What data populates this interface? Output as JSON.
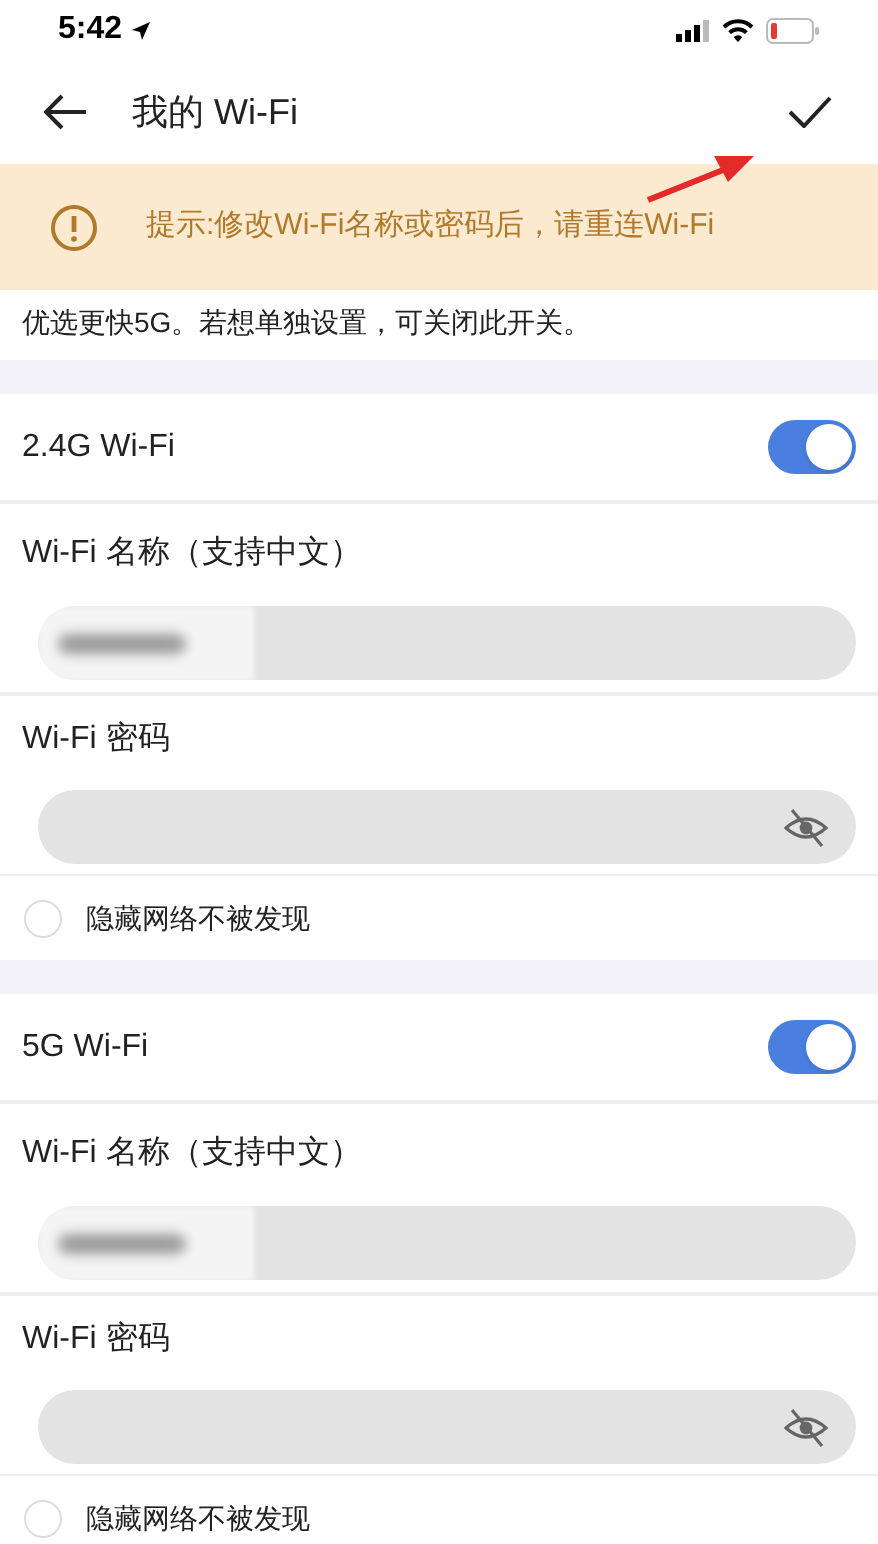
{
  "status_bar": {
    "time": "5:42"
  },
  "nav": {
    "title": "我的 Wi-Fi"
  },
  "notice": {
    "text": "提示:修改Wi-Fi名称或密码后，请重连Wi-Fi"
  },
  "description": "优选更快5G。若想单独设置，可关闭此开关。",
  "bands": [
    {
      "label": "2.4G Wi-Fi",
      "on": true,
      "name_label": "Wi-Fi 名称（支持中文）",
      "password_label": "Wi-Fi 密码",
      "hide_label": "隐藏网络不被发现",
      "hidden": false
    },
    {
      "label": "5G Wi-Fi",
      "on": true,
      "name_label": "Wi-Fi 名称（支持中文）",
      "password_label": "Wi-Fi 密码",
      "hide_label": "隐藏网络不被发现",
      "hidden": false
    }
  ]
}
